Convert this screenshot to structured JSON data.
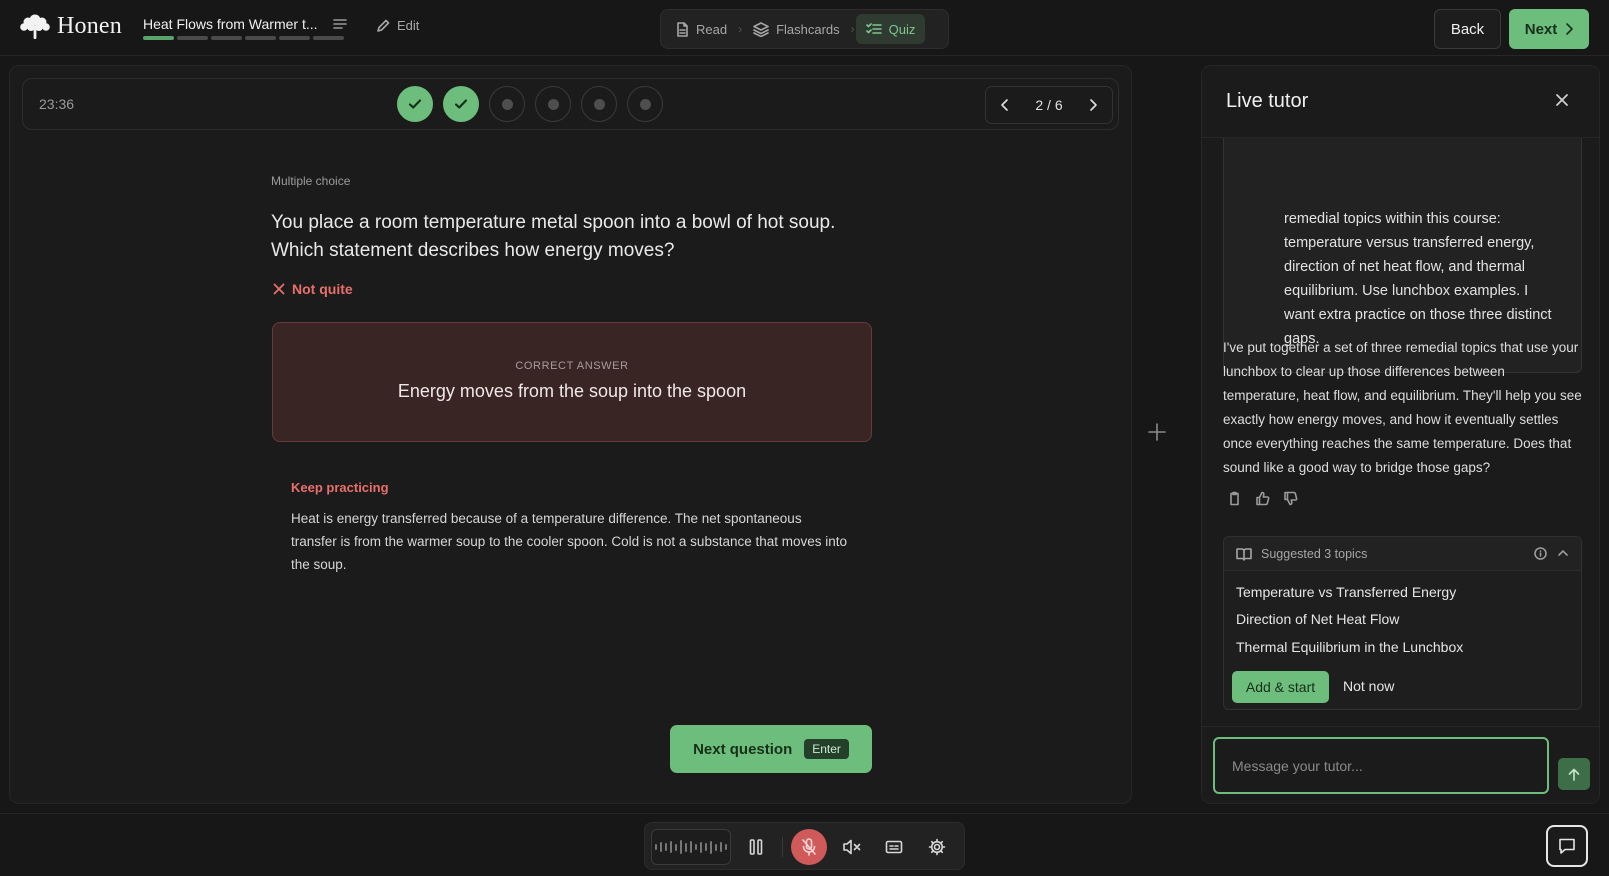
{
  "header": {
    "logo_text": "Honen",
    "doc_title": "Heat Flows from Warmer t...",
    "progress": {
      "total": 6,
      "completed": 2
    },
    "edit_label": "Edit",
    "modes": [
      {
        "label": "Read",
        "icon": "document-icon",
        "active": false
      },
      {
        "label": "Flashcards",
        "icon": "layers-icon",
        "active": false
      },
      {
        "label": "Quiz",
        "icon": "checklist-icon",
        "active": true
      }
    ],
    "back_label": "Back",
    "next_label": "Next"
  },
  "quiz": {
    "timer": "23:36",
    "questions": [
      {
        "status": "correct"
      },
      {
        "status": "correct"
      },
      {
        "status": "pending"
      },
      {
        "status": "pending"
      },
      {
        "status": "pending"
      },
      {
        "status": "pending"
      }
    ],
    "pager_text": "2 / 6",
    "question_type": "Multiple choice",
    "question_text": "You place a room temperature metal spoon into a bowl of hot soup. Which statement describes how energy moves?",
    "feedback_label": "Not quite",
    "correct_answer_label": "CORRECT ANSWER",
    "correct_answer": "Energy moves from the soup into the spoon",
    "keep_practicing_label": "Keep practicing",
    "explanation": "Heat is energy transferred because of a temperature difference. The net spontaneous transfer is from the warmer soup to the cooler spoon. Cold is not a substance that moves into the soup.",
    "next_question_label": "Next question",
    "next_question_key": "Enter"
  },
  "tutor": {
    "title": "Live tutor",
    "user_message": "remedial topics within this course: temperature versus transferred energy, direction of net heat flow, and thermal equilibrium. Use lunchbox examples. I want extra practice on those three distinct gaps.",
    "ai_message": "I've put together a set of three remedial topics that use your lunchbox to clear up those differences between temperature, heat flow, and equilibrium. They'll help you see exactly how energy moves, and how it eventually settles once everything reaches the same temperature. Does that sound like a good way to bridge those gaps?",
    "suggested_label": "Suggested 3 topics",
    "topics": [
      "Temperature vs Transferred Energy",
      "Direction of Net Heat Flow",
      "Thermal Equilibrium in the Lunchbox"
    ],
    "add_start_label": "Add & start",
    "not_now_label": "Not now",
    "input_placeholder": "Message your tutor..."
  },
  "colors": {
    "accent": "#6dbd7c",
    "error": "#e8706a",
    "background": "#171717"
  }
}
